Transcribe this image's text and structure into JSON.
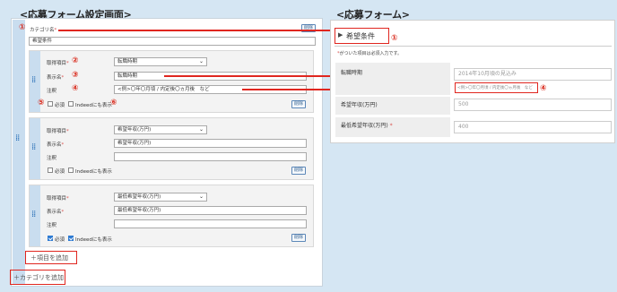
{
  "left_heading": "<応募フォーム設定画面>",
  "right_heading": "<応募フォーム>",
  "annotation_numbers": [
    "①",
    "②",
    "③",
    "④",
    "⑤",
    "⑥",
    "①",
    "④"
  ],
  "category": {
    "name_label": "カテゴリ名",
    "name_value": "希望条件",
    "delete_label": "削除"
  },
  "items": [
    {
      "field_label": "取得項目",
      "field_value": "転職時期",
      "display_label": "表示名",
      "display_value": "転職時期",
      "note_label": "注釈",
      "note_value": "<例>〇年〇月頃 / 内定後〇ヵ月後　など",
      "required_label": "必須",
      "required_checked": false,
      "indeed_label": "Indeedにも表示",
      "indeed_checked": false,
      "delete_label": "削除"
    },
    {
      "field_label": "取得項目",
      "field_value": "希望年収(万円)",
      "display_label": "表示名",
      "display_value": "希望年収(万円)",
      "note_label": "注釈",
      "note_value": "",
      "required_label": "必須",
      "required_checked": false,
      "indeed_label": "Indeedにも表示",
      "indeed_checked": false,
      "delete_label": "削除"
    },
    {
      "field_label": "取得項目",
      "field_value": "最低希望年収(万円)",
      "display_label": "表示名",
      "display_value": "最低希望年収(万円)",
      "note_label": "注釈",
      "note_value": "",
      "required_label": "必須",
      "required_checked": true,
      "indeed_label": "Indeedにも表示",
      "indeed_checked": true,
      "delete_label": "削除"
    }
  ],
  "add_item_label": "＋項目を追加",
  "add_category_label": "＋カテゴリを追加",
  "form": {
    "section_title": "希望条件",
    "required_note": "がついた項目は必須入力です。",
    "rows": [
      {
        "label": "転職時期",
        "value": "2014年10月頃の見込み",
        "note": "<例>〇年〇月頃 / 内定後〇ヵ月後　など",
        "required": false
      },
      {
        "label": "希望年収(万円)",
        "value": "500",
        "required": false
      },
      {
        "label": "最低希望年収(万円)",
        "value": "400",
        "required": true
      }
    ]
  },
  "colors": {
    "annotation_red": "#e0261f",
    "accent_blue": "#2f7bd2",
    "background": "#d5e6f3"
  }
}
